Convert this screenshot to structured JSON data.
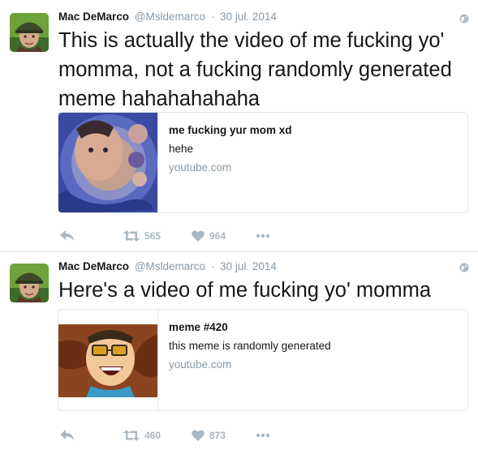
{
  "colors": {
    "text": "#14171a",
    "meta": "#8899a6",
    "action_icon": "#aab8c2",
    "border": "#e1e8ed"
  },
  "tweets": [
    {
      "author_name": "Mac DeMarco",
      "handle": "@Msldemarco",
      "separator": "·",
      "date": "30 jul. 2014",
      "text": "This is actually the video of me fucking yo' momma, not a fucking randomly generated meme hahahahahaha",
      "card": {
        "title": "me fucking yur mom xd",
        "description": "hehe",
        "domain": "youtube.com",
        "thumbnail": "swirled-face-thumbnail"
      },
      "retweets": "565",
      "likes": "964"
    },
    {
      "author_name": "Mac DeMarco",
      "handle": "@Msldemarco",
      "separator": "·",
      "date": "30 jul. 2014",
      "text": "Here's a video of me fucking yo' momma",
      "card": {
        "title": "meme #420",
        "description": "this meme is randomly generated",
        "domain": "youtube.com",
        "thumbnail": "cartoon-character-thumbnail"
      },
      "retweets": "460",
      "likes": "873"
    }
  ],
  "icons": {
    "avatar": "avatar-image",
    "globe": "globe-icon",
    "reply": "reply-icon",
    "retweet": "retweet-icon",
    "like": "heart-icon",
    "more": "more-icon"
  }
}
